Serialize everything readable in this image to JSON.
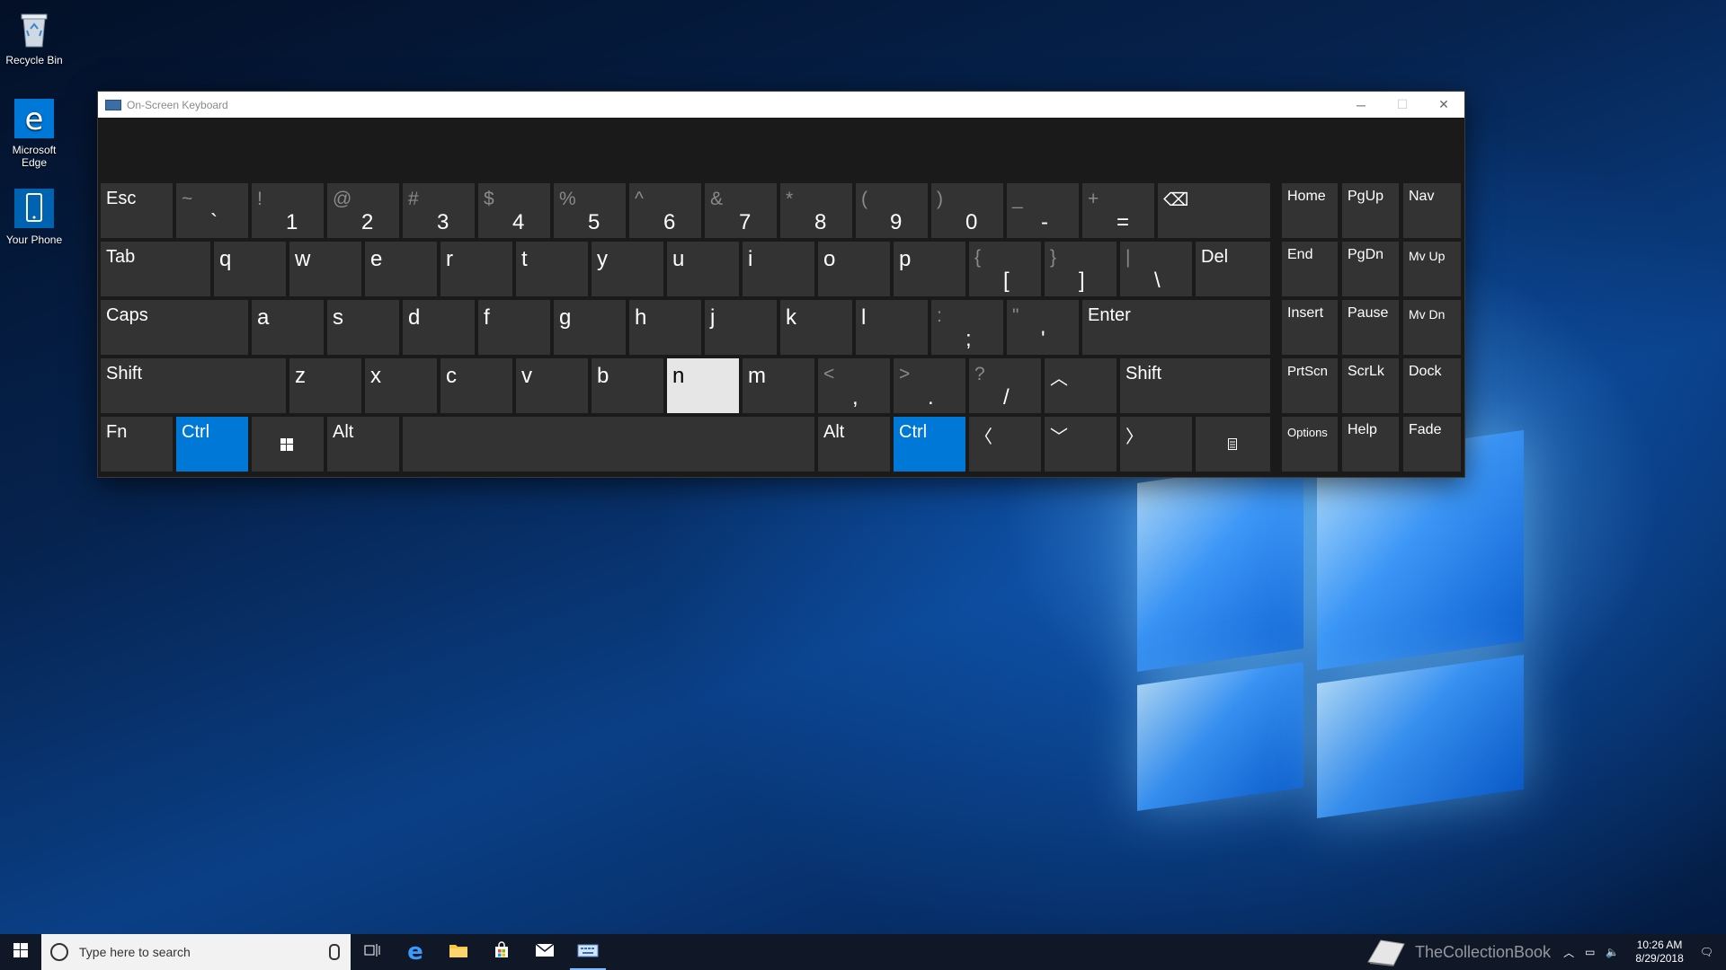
{
  "desktop": {
    "icons": [
      {
        "label": "Recycle Bin",
        "icon": "recycle-bin-icon"
      },
      {
        "label": "Microsoft Edge",
        "icon": "edge-icon"
      },
      {
        "label": "Your Phone",
        "icon": "phone-icon"
      }
    ]
  },
  "osk": {
    "title": "On-Screen Keyboard",
    "window_buttons": {
      "minimize": "─",
      "maximize": "☐",
      "close": "✕"
    },
    "colors": {
      "key_bg": "#333333",
      "highlight": "#0078d7",
      "pressed": "#e6e6e6"
    },
    "keys": {
      "esc": "Esc",
      "n1": {
        "shift": "~",
        "main": "`"
      },
      "n2": {
        "shift": "!",
        "main": "1"
      },
      "n3": {
        "shift": "@",
        "main": "2"
      },
      "n4": {
        "shift": "#",
        "main": "3"
      },
      "n5": {
        "shift": "$",
        "main": "4"
      },
      "n6": {
        "shift": "%",
        "main": "5"
      },
      "n7": {
        "shift": "^",
        "main": "6"
      },
      "n8": {
        "shift": "&",
        "main": "7"
      },
      "n9": {
        "shift": "*",
        "main": "8"
      },
      "n10": {
        "shift": "(",
        "main": "9"
      },
      "n11": {
        "shift": ")",
        "main": "0"
      },
      "n12": {
        "shift": "_",
        "main": "-"
      },
      "n13": {
        "shift": "+",
        "main": "="
      },
      "backspace": "⌫",
      "tab": "Tab",
      "q": "q",
      "w": "w",
      "e": "e",
      "r": "r",
      "t": "t",
      "y": "y",
      "u": "u",
      "i": "i",
      "o": "o",
      "p": "p",
      "lbracket": {
        "shift": "{",
        "main": "["
      },
      "rbracket": {
        "shift": "}",
        "main": "]"
      },
      "backslash": {
        "shift": "|",
        "main": "\\"
      },
      "del": "Del",
      "caps": "Caps",
      "a": "a",
      "s": "s",
      "d": "d",
      "f": "f",
      "g": "g",
      "h": "h",
      "j": "j",
      "k": "k",
      "l": "l",
      "semicolon": {
        "shift": ":",
        "main": ";"
      },
      "quote": {
        "shift": "\"",
        "main": "'"
      },
      "enter": "Enter",
      "lshift": "Shift",
      "z": "z",
      "x": "x",
      "c": "c",
      "v": "v",
      "b": "b",
      "n": "n",
      "m": "m",
      "comma": {
        "shift": "<",
        "main": ","
      },
      "period": {
        "shift": ">",
        "main": "."
      },
      "slash": {
        "shift": "?",
        "main": "/"
      },
      "up": "︿",
      "rshift": "Shift",
      "fn": "Fn",
      "lctrl": "Ctrl",
      "lalt": "Alt",
      "ralt": "Alt",
      "rctrl": "Ctrl",
      "left": "〈",
      "down": "﹀",
      "right": "〉",
      "home": "Home",
      "pgup": "PgUp",
      "nav": "Nav",
      "end": "End",
      "pgdn": "PgDn",
      "mvup": "Mv Up",
      "insert": "Insert",
      "pause": "Pause",
      "mvdn": "Mv Dn",
      "prtscn": "PrtScn",
      "scrlk": "ScrLk",
      "dock": "Dock",
      "options": "Options",
      "help": "Help",
      "fade": "Fade"
    }
  },
  "taskbar": {
    "search_placeholder": "Type here to search",
    "watermark": "TheCollectionBook",
    "clock": {
      "time": "10:26 AM",
      "date": "8/29/2018"
    }
  }
}
